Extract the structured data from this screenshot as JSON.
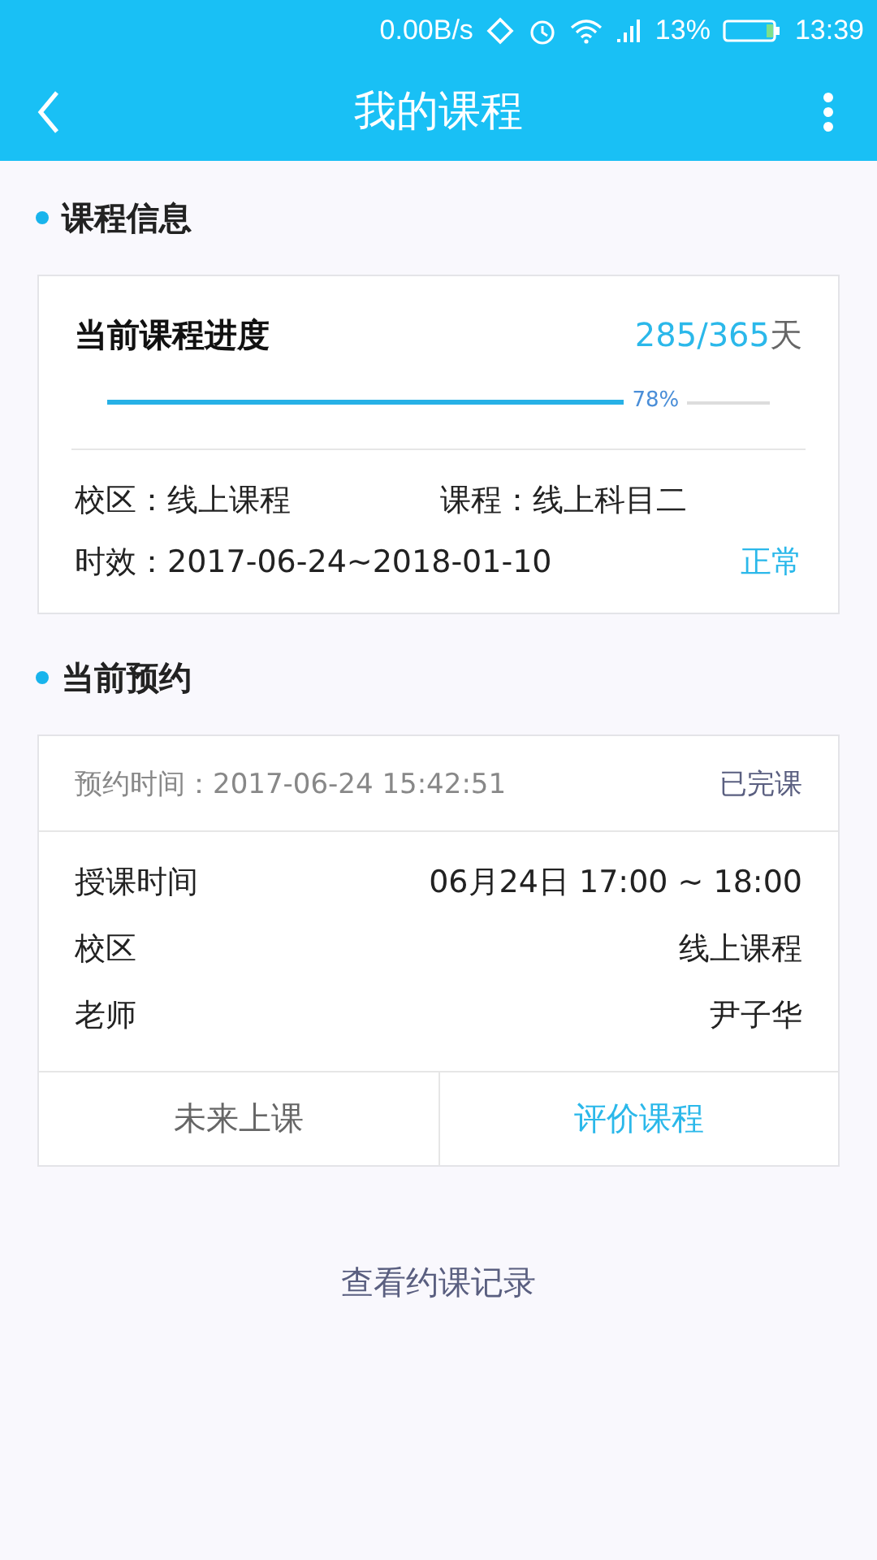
{
  "status_bar": {
    "speed": "0.00B/s",
    "battery_text": "13%",
    "time": "13:39"
  },
  "app_bar": {
    "title": "我的课程"
  },
  "course_info": {
    "heading": "课程信息",
    "progress_title": "当前课程进度",
    "days_done": "285/365",
    "days_unit": "天",
    "progress": {
      "level": 0.78,
      "label": "78%"
    },
    "campus_label": "校区：",
    "campus": "线上课程",
    "course_label": "课程：",
    "course": "线上科目二",
    "validity_label": "时效：",
    "validity": "2017-06-24~2018-01-10",
    "status": "正常"
  },
  "booking": {
    "heading": "当前预约",
    "booked_label": "预约时间：",
    "booked_time": "2017-06-24 15:42:51",
    "state": "已完课",
    "rows": [
      {
        "label": "授课时间",
        "value": "06月24日 17:00 ~ 18:00"
      },
      {
        "label": "校区",
        "value": "线上课程"
      },
      {
        "label": "老师",
        "value": "尹子华"
      }
    ],
    "actions": [
      {
        "label": "未来上课",
        "kind": "plain"
      },
      {
        "label": "评价课程",
        "kind": "accent"
      }
    ]
  },
  "history_link": "查看约课记录"
}
